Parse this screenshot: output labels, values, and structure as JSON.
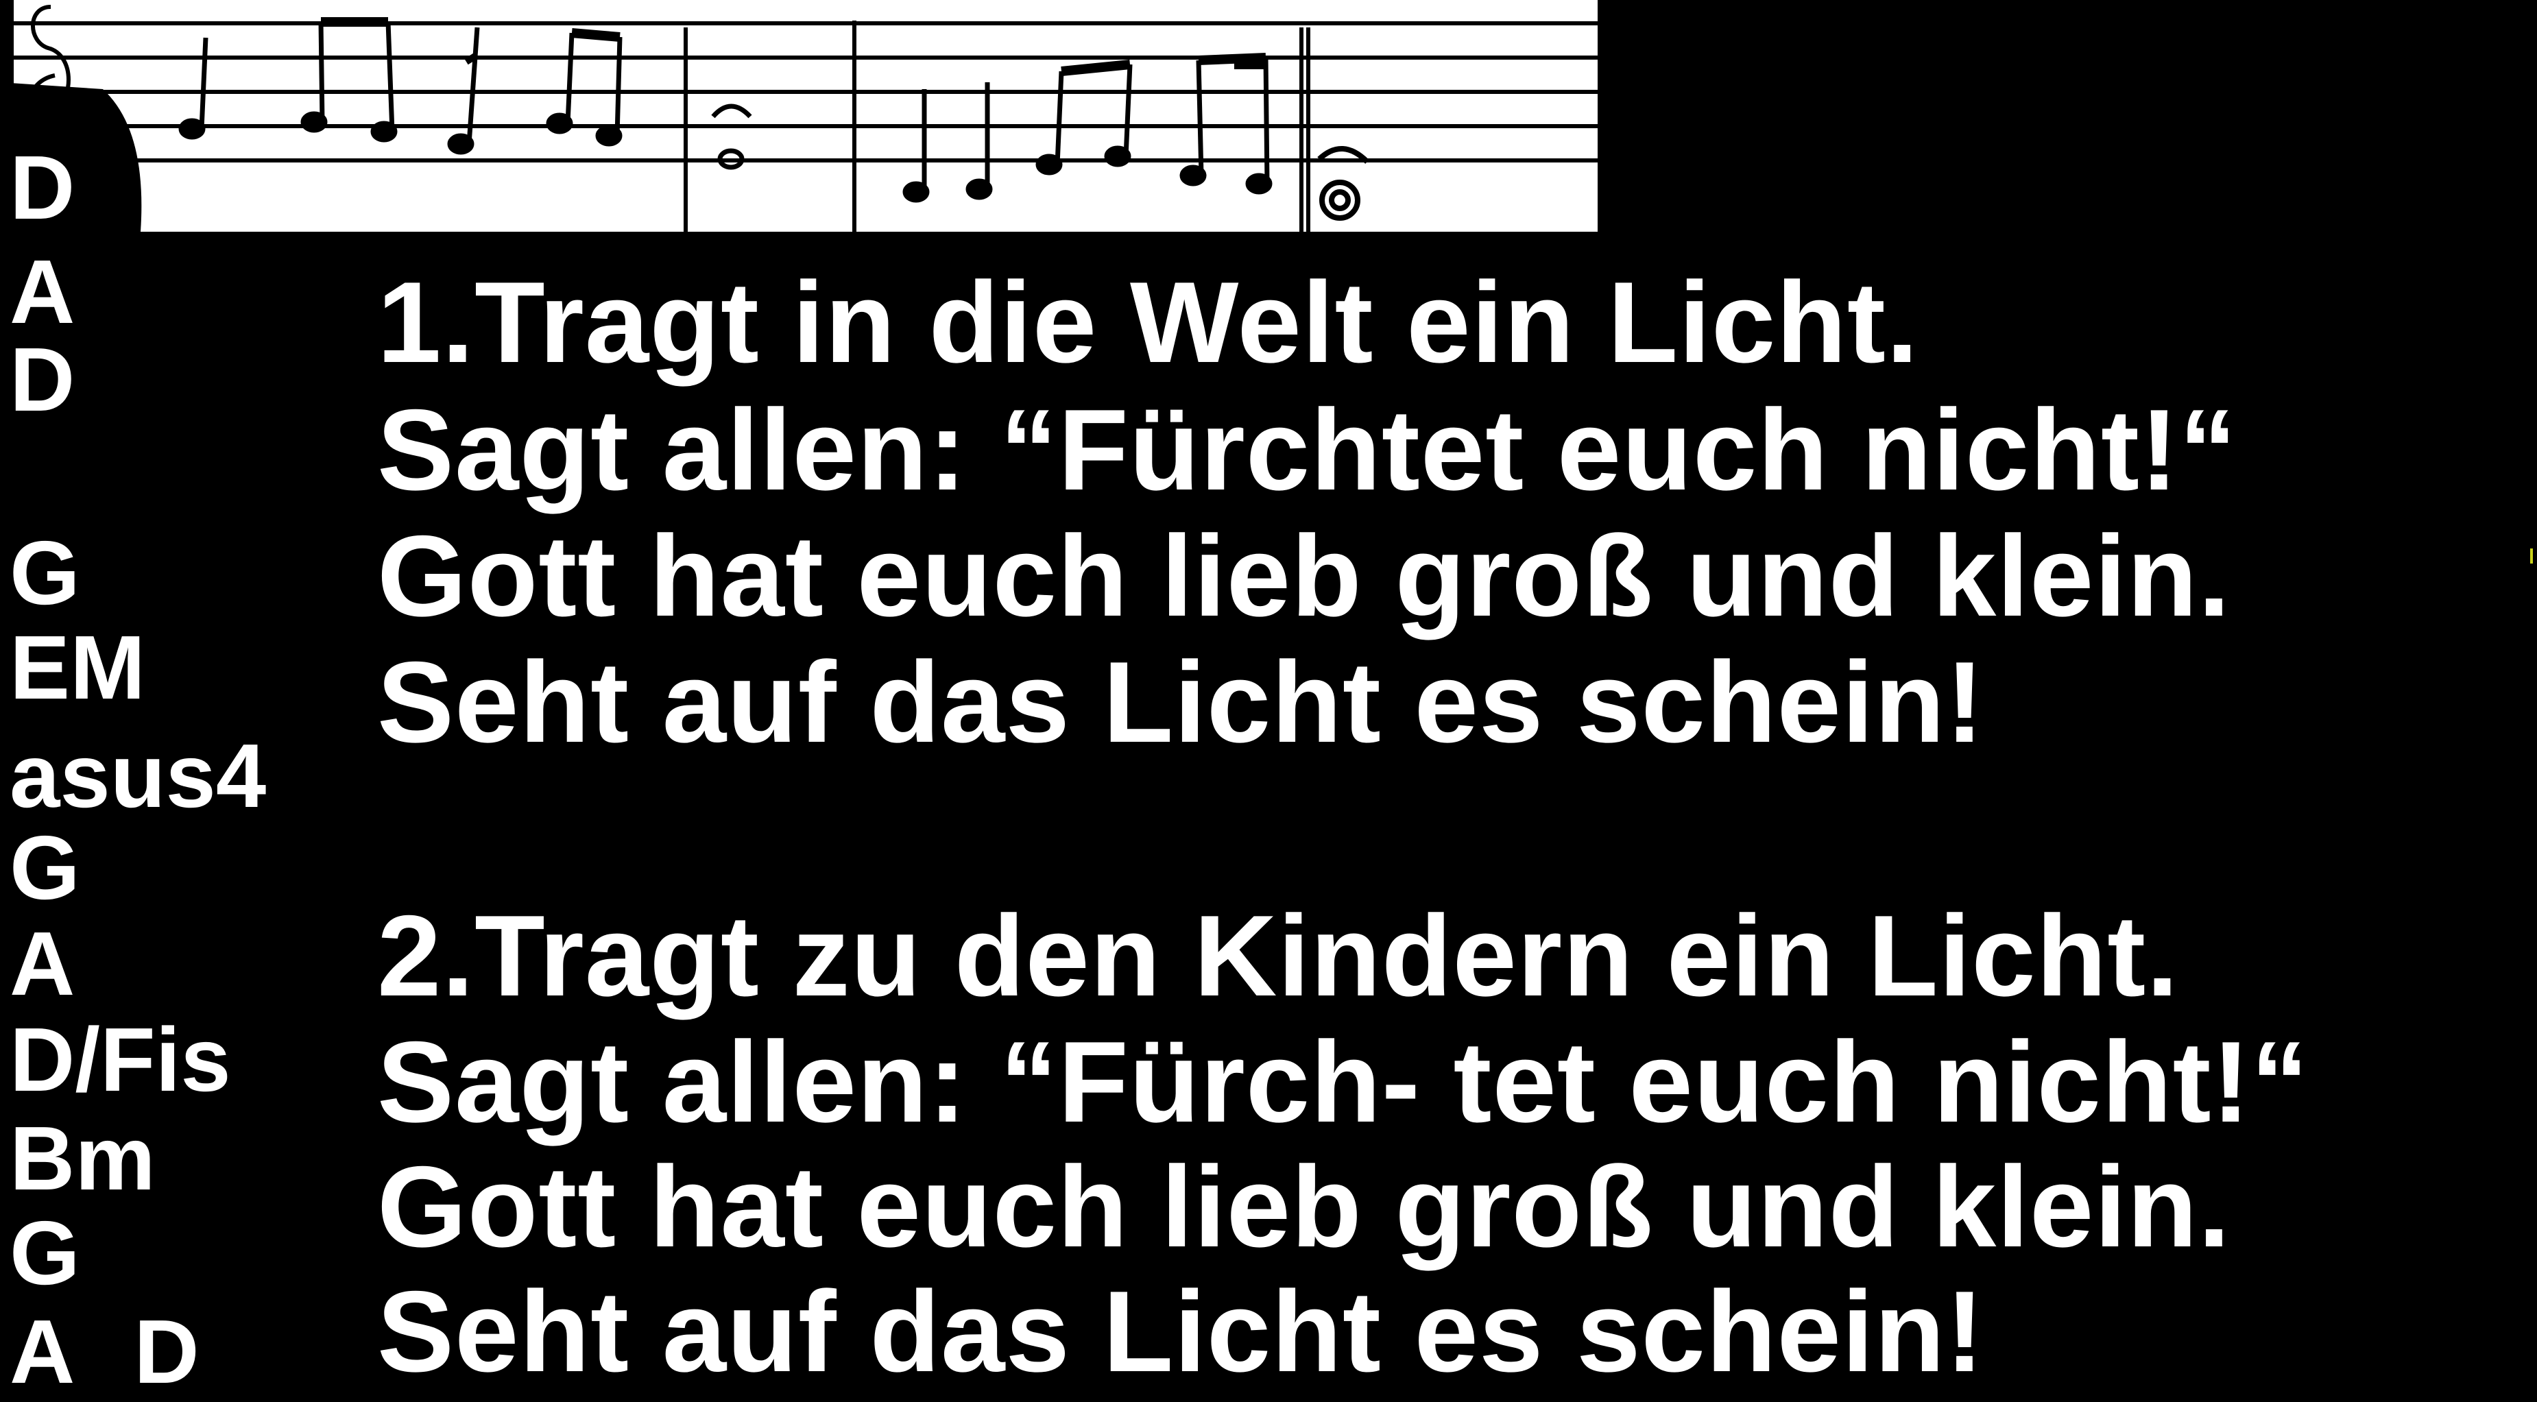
{
  "colors": {
    "background": "#000000",
    "text": "#ffffff",
    "sheet_music_paper": "#ffffff",
    "sheet_music_ink": "#000000"
  },
  "chords": [
    {
      "a": "D"
    },
    {
      "a": "A"
    },
    {
      "a": "D"
    },
    {
      "a": "G"
    },
    {
      "a": "EM"
    },
    {
      "a": "asus4"
    },
    {
      "a": "G"
    },
    {
      "a": "A"
    },
    {
      "a": "D/Fis"
    },
    {
      "a": "Bm"
    },
    {
      "a": "G"
    },
    {
      "a": "A",
      "b": "D"
    }
  ],
  "verse1": [
    "1.Tragt in die Welt ein Licht.",
    "Sagt allen: “Fürchtet euch nicht!“",
    "Gott hat euch lieb groß und klein.",
    "Seht auf das Licht es schein!"
  ],
  "verse2": [
    "2.Tragt zu den Kindern ein Licht.",
    "Sagt allen: “Fürch- tet euch nicht!“",
    "Gott hat euch lieb groß und klein.",
    "Seht auf das Licht es schein!"
  ]
}
